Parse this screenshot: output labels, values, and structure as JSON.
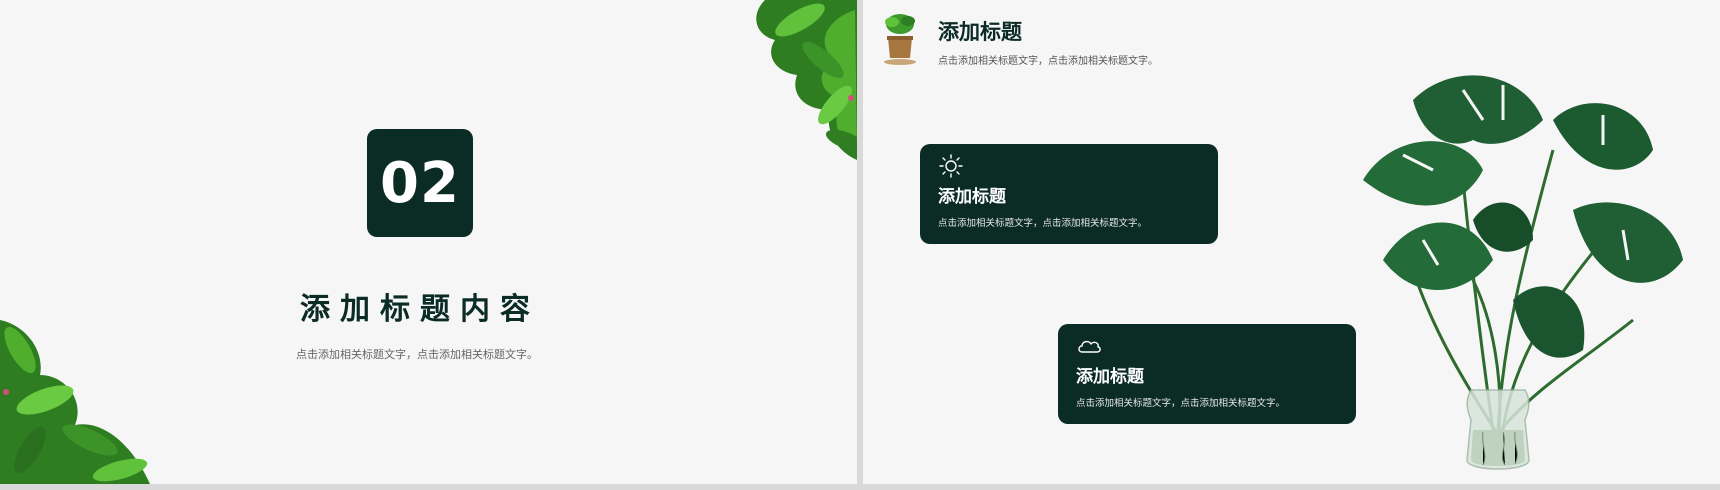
{
  "left_slide": {
    "number": "02",
    "title": "添加标题内容",
    "subtitle": "点击添加相关标题文字，点击添加相关标题文字。"
  },
  "right_slide": {
    "header": {
      "title": "添加标题",
      "subtitle": "点击添加相关标题文字，点击添加相关标题文字。"
    },
    "cards": [
      {
        "icon": "sun-icon",
        "title": "添加标题",
        "text": "点击添加相关标题文字，点击添加相关标题文字。"
      },
      {
        "icon": "cloud-icon",
        "title": "添加标题",
        "text": "点击添加相关标题文字，点击添加相关标题文字。"
      }
    ]
  },
  "colors": {
    "accent_dark_green": "#0b2b25",
    "slide_background": "#f6f6f6",
    "leaf_green": "#3f9a2c",
    "monstera_green": "#1f5f33"
  }
}
